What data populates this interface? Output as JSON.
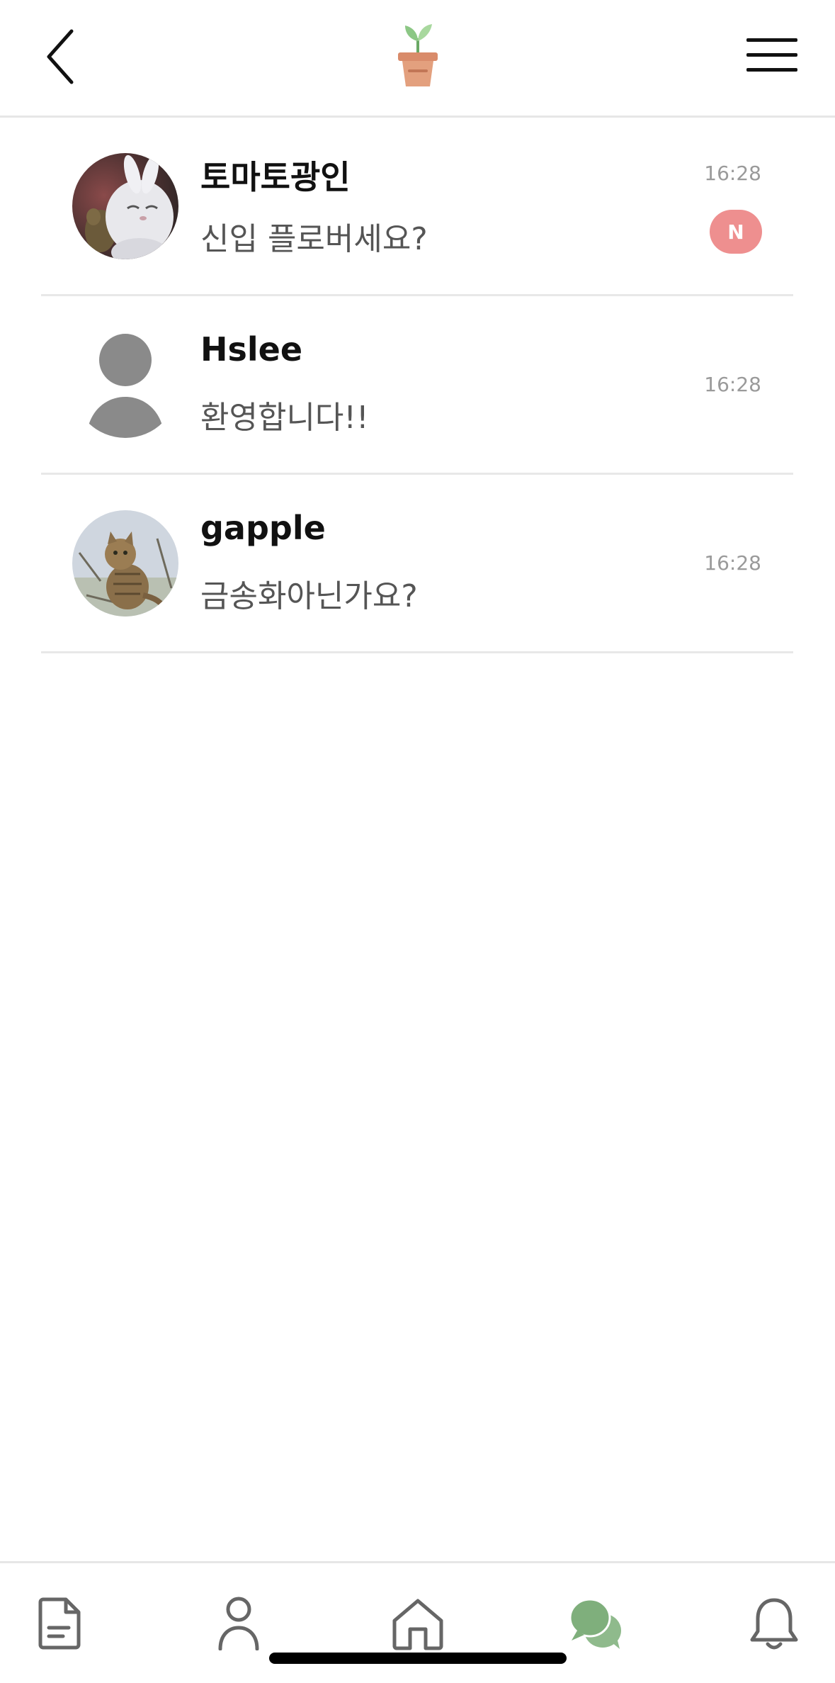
{
  "header": {
    "back_icon": "chevron-left-icon",
    "logo_icon": "potted-sprout-icon",
    "menu_icon": "hamburger-menu-icon"
  },
  "chats": [
    {
      "name": "토마토광인",
      "message": "신입 플로버세요?",
      "time": "16:28",
      "badge": "N",
      "avatar": "white-cat-cartoon-avatar"
    },
    {
      "name": "Hslee",
      "message": "환영합니다!!",
      "time": "16:28",
      "avatar": "default-person-avatar"
    },
    {
      "name": "gapple",
      "message": "금송화아닌가요?",
      "time": "16:28",
      "avatar": "tabby-cat-photo-avatar"
    }
  ],
  "bottom_nav": {
    "items": [
      {
        "icon": "document-icon",
        "active": false
      },
      {
        "icon": "person-icon",
        "active": false
      },
      {
        "icon": "home-icon",
        "active": false
      },
      {
        "icon": "chat-bubbles-icon",
        "active": true
      },
      {
        "icon": "bell-icon",
        "active": false
      }
    ]
  },
  "colors": {
    "accent_green": "#8fba8c",
    "badge_red": "#ee8f8f",
    "icon_gray": "#666666",
    "divider": "#e8e8e8"
  }
}
